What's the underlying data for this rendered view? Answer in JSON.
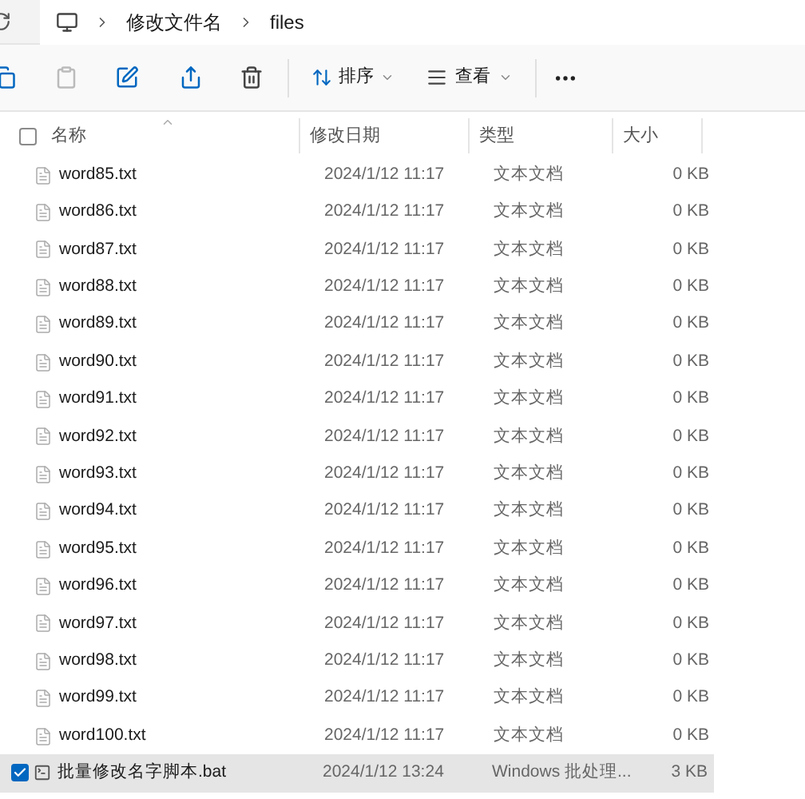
{
  "breadcrumb": [
    "修改文件名",
    "files"
  ],
  "toolbar": {
    "sort": "排序",
    "view": "查看"
  },
  "columns": [
    {
      "label": "名称",
      "sorted": true
    },
    {
      "label": "修改日期",
      "sorted": false
    },
    {
      "label": "类型",
      "sorted": false
    },
    {
      "label": "大小",
      "sorted": false
    }
  ],
  "header_checkbox": {
    "checked": false
  },
  "rows": [
    {
      "kind": "text",
      "name": "word85.txt",
      "date": "2024/1/12 11:17",
      "type": "文本文档",
      "size": "0 KB",
      "selected": false
    },
    {
      "kind": "text",
      "name": "word86.txt",
      "date": "2024/1/12 11:17",
      "type": "文本文档",
      "size": "0 KB",
      "selected": false
    },
    {
      "kind": "text",
      "name": "word87.txt",
      "date": "2024/1/12 11:17",
      "type": "文本文档",
      "size": "0 KB",
      "selected": false
    },
    {
      "kind": "text",
      "name": "word88.txt",
      "date": "2024/1/12 11:17",
      "type": "文本文档",
      "size": "0 KB",
      "selected": false
    },
    {
      "kind": "text",
      "name": "word89.txt",
      "date": "2024/1/12 11:17",
      "type": "文本文档",
      "size": "0 KB",
      "selected": false
    },
    {
      "kind": "text",
      "name": "word90.txt",
      "date": "2024/1/12 11:17",
      "type": "文本文档",
      "size": "0 KB",
      "selected": false
    },
    {
      "kind": "text",
      "name": "word91.txt",
      "date": "2024/1/12 11:17",
      "type": "文本文档",
      "size": "0 KB",
      "selected": false
    },
    {
      "kind": "text",
      "name": "word92.txt",
      "date": "2024/1/12 11:17",
      "type": "文本文档",
      "size": "0 KB",
      "selected": false
    },
    {
      "kind": "text",
      "name": "word93.txt",
      "date": "2024/1/12 11:17",
      "type": "文本文档",
      "size": "0 KB",
      "selected": false
    },
    {
      "kind": "text",
      "name": "word94.txt",
      "date": "2024/1/12 11:17",
      "type": "文本文档",
      "size": "0 KB",
      "selected": false
    },
    {
      "kind": "text",
      "name": "word95.txt",
      "date": "2024/1/12 11:17",
      "type": "文本文档",
      "size": "0 KB",
      "selected": false
    },
    {
      "kind": "text",
      "name": "word96.txt",
      "date": "2024/1/12 11:17",
      "type": "文本文档",
      "size": "0 KB",
      "selected": false
    },
    {
      "kind": "text",
      "name": "word97.txt",
      "date": "2024/1/12 11:17",
      "type": "文本文档",
      "size": "0 KB",
      "selected": false
    },
    {
      "kind": "text",
      "name": "word98.txt",
      "date": "2024/1/12 11:17",
      "type": "文本文档",
      "size": "0 KB",
      "selected": false
    },
    {
      "kind": "text",
      "name": "word99.txt",
      "date": "2024/1/12 11:17",
      "type": "文本文档",
      "size": "0 KB",
      "selected": false
    },
    {
      "kind": "text",
      "name": "word100.txt",
      "date": "2024/1/12 11:17",
      "type": "文本文档",
      "size": "0 KB",
      "selected": false
    },
    {
      "kind": "batch",
      "name": "批量修改名字脚本.bat",
      "date": "2024/1/12 13:24",
      "type": "Windows 批处理...",
      "size": "3 KB",
      "selected": true
    }
  ]
}
